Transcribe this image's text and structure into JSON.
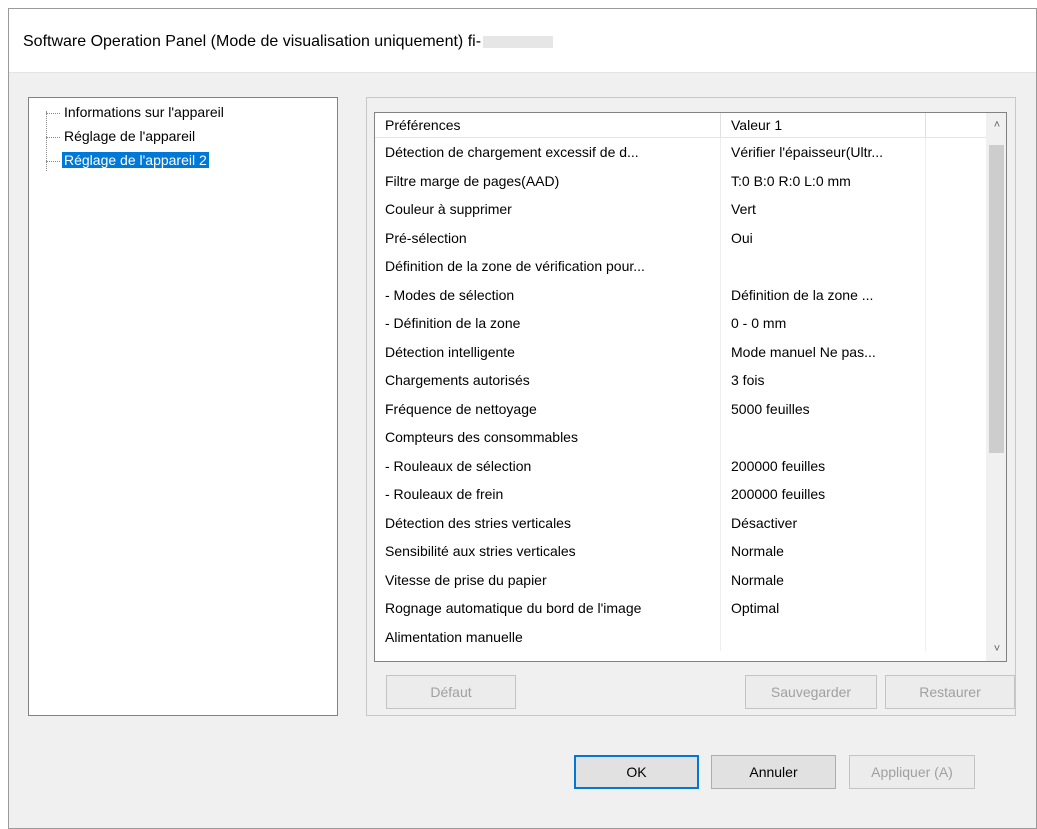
{
  "window": {
    "title": "Software Operation Panel (Mode de visualisation uniquement) fi-"
  },
  "tree": {
    "items": [
      {
        "label": "Informations sur l'appareil",
        "selected": false
      },
      {
        "label": "Réglage de l'appareil",
        "selected": false
      },
      {
        "label": "Réglage de l'appareil 2",
        "selected": true
      }
    ]
  },
  "table": {
    "headers": [
      "Préférences",
      "Valeur 1",
      ""
    ],
    "rows": [
      {
        "pref": "Détection de chargement excessif de d...",
        "value": "Vérifier l'épaisseur(Ultr..."
      },
      {
        "pref": "Filtre marge de pages(AAD)",
        "value": "T:0  B:0  R:0  L:0 mm"
      },
      {
        "pref": "Couleur à supprimer",
        "value": "Vert"
      },
      {
        "pref": "Pré-sélection",
        "value": "Oui"
      },
      {
        "pref": "Définition de la zone de vérification pour...",
        "value": ""
      },
      {
        "pref": " - Modes de sélection",
        "value": "Définition de la zone ..."
      },
      {
        "pref": " - Définition de la zone",
        "value": "0 - 0 mm"
      },
      {
        "pref": "Détection intelligente",
        "value": "Mode manuel  Ne pas..."
      },
      {
        "pref": "Chargements autorisés",
        "value": "3 fois"
      },
      {
        "pref": "Fréquence de nettoyage",
        "value": "5000 feuilles"
      },
      {
        "pref": "Compteurs des consommables",
        "value": ""
      },
      {
        "pref": " - Rouleaux de sélection",
        "value": "200000 feuilles"
      },
      {
        "pref": " - Rouleaux de frein",
        "value": "200000 feuilles"
      },
      {
        "pref": "Détection des stries verticales",
        "value": "Désactiver"
      },
      {
        "pref": "Sensibilité aux stries verticales",
        "value": "Normale"
      },
      {
        "pref": "Vitesse de prise du papier",
        "value": "Normale"
      },
      {
        "pref": "Rognage automatique du bord de l'image",
        "value": "Optimal"
      },
      {
        "pref": "Alimentation manuelle",
        "value": ""
      }
    ]
  },
  "buttons": {
    "default": "Défaut",
    "save": "Sauvegarder",
    "restore": "Restaurer",
    "ok": "OK",
    "cancel": "Annuler",
    "apply": "Appliquer (A)"
  },
  "icons": {
    "scroll_up": "chevron-up-icon",
    "scroll_down": "chevron-down-icon"
  }
}
